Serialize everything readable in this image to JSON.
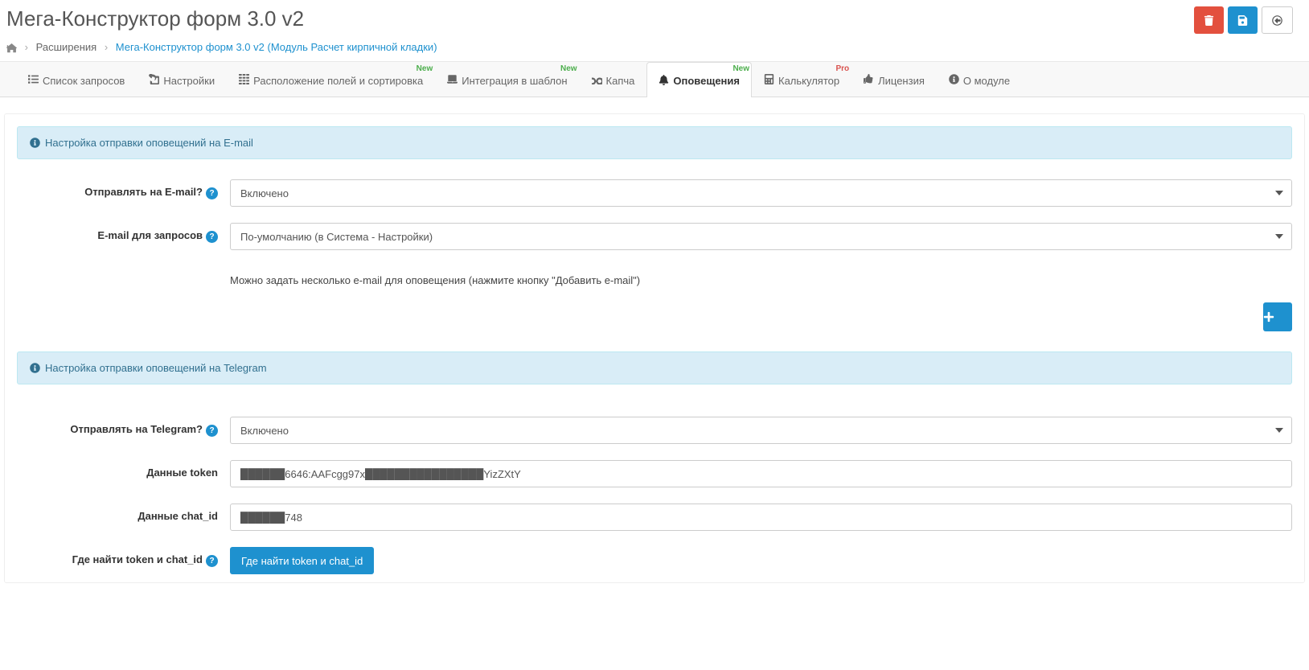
{
  "header": {
    "title": "Мега-Конструктор форм 3.0 v2"
  },
  "breadcrumb": {
    "home": "",
    "extensions": "Расширения",
    "current": "Мега-Конструктор форм 3.0 v2",
    "suffix": "(Модуль Расчет кирпичной кладки)"
  },
  "tabs": [
    {
      "label": "Список запросов",
      "badge": ""
    },
    {
      "label": "Настройки",
      "badge": ""
    },
    {
      "label": "Расположение полей и сортировка",
      "badge": "New"
    },
    {
      "label": "Интеграция в шаблон",
      "badge": "New"
    },
    {
      "label": "Капча",
      "badge": ""
    },
    {
      "label": "Оповещения",
      "badge": "New",
      "active": true
    },
    {
      "label": "Калькулятор",
      "badge": "Pro"
    },
    {
      "label": "Лицензия",
      "badge": ""
    },
    {
      "label": "О модуле",
      "badge": ""
    }
  ],
  "sections": {
    "email": {
      "title": "Настройка отправки оповещений на E-mail",
      "send_label": "Отправлять на E-mail?",
      "send_value": "Включено",
      "requests_label": "E-mail для запросов",
      "requests_value": "По-умолчанию (в Система - Настройки)",
      "help": "Можно задать несколько e-mail для оповещения (нажмите кнопку \"Добавить e-mail\")"
    },
    "telegram": {
      "title": "Настройка отправки оповещений на Telegram",
      "send_label": "Отправлять на Telegram?",
      "send_value": "Включено",
      "token_label": "Данные token",
      "token_value": "██████6646:AAFcgg97x████████████████YizZXtY",
      "chatid_label": "Данные chat_id",
      "chatid_value": "██████748",
      "where_label": "Где найти token и chat_id",
      "where_button": "Где найти token и chat_id"
    }
  }
}
